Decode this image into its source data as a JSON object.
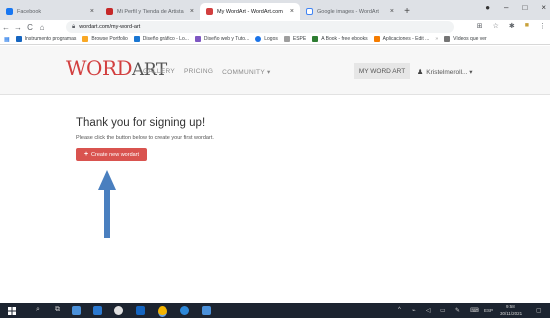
{
  "browser": {
    "tabs": [
      {
        "title": "Facebook",
        "color": "#1877f2",
        "active": false
      },
      {
        "title": "Mi Perfil y Tienda de Artista",
        "color": "#c62828",
        "active": false
      },
      {
        "title": "My WordArt - WordArt.com",
        "color": "#d23f3f",
        "active": true
      },
      {
        "title": "Google images - WordArt",
        "color": "#ffffff",
        "active": false
      }
    ],
    "new_tab": "+",
    "url": "wordart.com/my-word-art",
    "bookmarks": [
      {
        "label": "Instrumento programas",
        "color": "#1565c0"
      },
      {
        "label": "Browse Portfolio",
        "color": "#f9a825"
      },
      {
        "label": "Diseño gráfico - Lo...",
        "color": "#1976d2"
      },
      {
        "label": "Diseño web y Tuto...",
        "color": "#7e57c2"
      },
      {
        "label": "Logos",
        "color": "#1a73e8"
      },
      {
        "label": "ESPE",
        "color": "#9e9e9e"
      },
      {
        "label": "A Book - free ebooks",
        "color": "#2e7d32"
      },
      {
        "label": "Aplicaciones - Edit ...",
        "color": "#f57c00"
      },
      {
        "label": "Vídeos que ver",
        "color": "#757575"
      }
    ]
  },
  "site": {
    "logo_word": "WORD",
    "logo_art": "ART",
    "nav": [
      "GALLERY",
      "PRICING",
      "COMMUNITY ▾"
    ],
    "my_word_art": "MY WORD ART",
    "user_name": "Kristelmeroll... ▾"
  },
  "main": {
    "heading": "Thank you for signing up!",
    "subtext": "Please click the button below to create your first wordart.",
    "create_button": "Create new wordart"
  },
  "taskbar": {
    "language": "ESP",
    "time": "9:58",
    "date": "30/11/2021"
  },
  "colors": {
    "accent": "#d9534f",
    "arrow": "#4a7fbf",
    "taskbar": "#1c2430"
  }
}
